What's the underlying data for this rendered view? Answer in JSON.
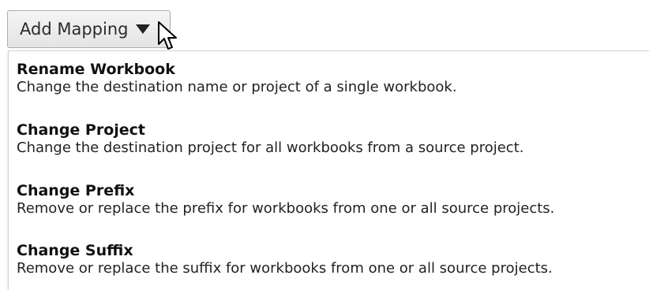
{
  "button": {
    "label": "Add Mapping",
    "caret_icon": "caret-down-icon"
  },
  "cursor_icon": "mouse-pointer-icon",
  "menu": {
    "items": [
      {
        "title": "Rename Workbook",
        "description": "Change the destination name or project of a single workbook."
      },
      {
        "title": "Change Project",
        "description": "Change the destination project for all workbooks from a source project."
      },
      {
        "title": "Change Prefix",
        "description": "Remove or replace the prefix for workbooks from one or all source projects."
      },
      {
        "title": "Change Suffix",
        "description": "Remove or replace the suffix for workbooks from one or all source projects."
      }
    ]
  }
}
